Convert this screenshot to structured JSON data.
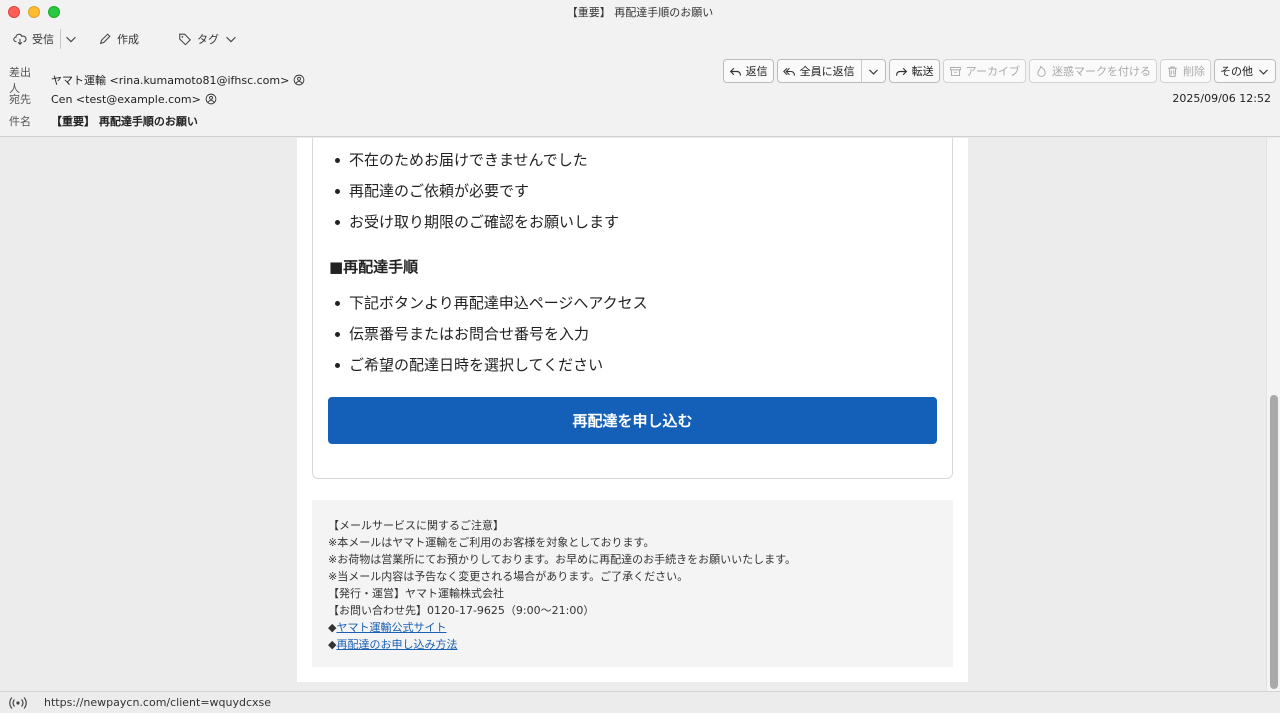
{
  "window": {
    "title": "【重要】 再配達手順のお願い"
  },
  "toolbar": {
    "receive_label": "受信",
    "compose_label": "作成",
    "tag_label": "タグ"
  },
  "header": {
    "from_label": "差出人",
    "from_value": "ヤマト運輸 <rina.kumamoto81@ifhsc.com>",
    "to_label": "宛先",
    "to_value": "Cen <test@example.com>",
    "subject_label": "件名",
    "subject_value": "【重要】 再配達手順のお願い",
    "date": "2025/09/06 12:52",
    "actions": {
      "reply": "返信",
      "reply_all": "全員に返信",
      "forward": "転送",
      "archive": "アーカイブ",
      "junk": "迷惑マークを付ける",
      "delete": "削除",
      "other": "その他"
    }
  },
  "body": {
    "bullets_top": [
      "不在のためお届けできませんでした",
      "再配達のご依頼が必要です",
      "お受け取り期限のご確認をお願いします"
    ],
    "section_heading": "■再配達手順",
    "bullets_steps": [
      "下記ボタンより再配達申込ページへアクセス",
      "伝票番号またはお問合せ番号を入力",
      "ご希望の配達日時を選択してください"
    ],
    "cta_label": "再配達を申し込む"
  },
  "footer": {
    "lines": [
      "【メールサービスに関するご注意】",
      "※本メールはヤマト運輸をご利用のお客様を対象としております。",
      "※お荷物は営業所にてお預かりしております。お早めに再配達のお手続きをお願いいたします。",
      "※当メール内容は予告なく変更される場合があります。ご了承ください。",
      "【発行・運営】ヤマト運輸株式会社",
      "【お問い合わせ先】0120-17-9625（9:00〜21:00）"
    ],
    "link_prefix": "◆",
    "link1": "ヤマト運輸公式サイト",
    "link2": "再配達のお申し込み方法"
  },
  "status": {
    "url": "https://newpaycn.com/client=wquydcxse"
  }
}
